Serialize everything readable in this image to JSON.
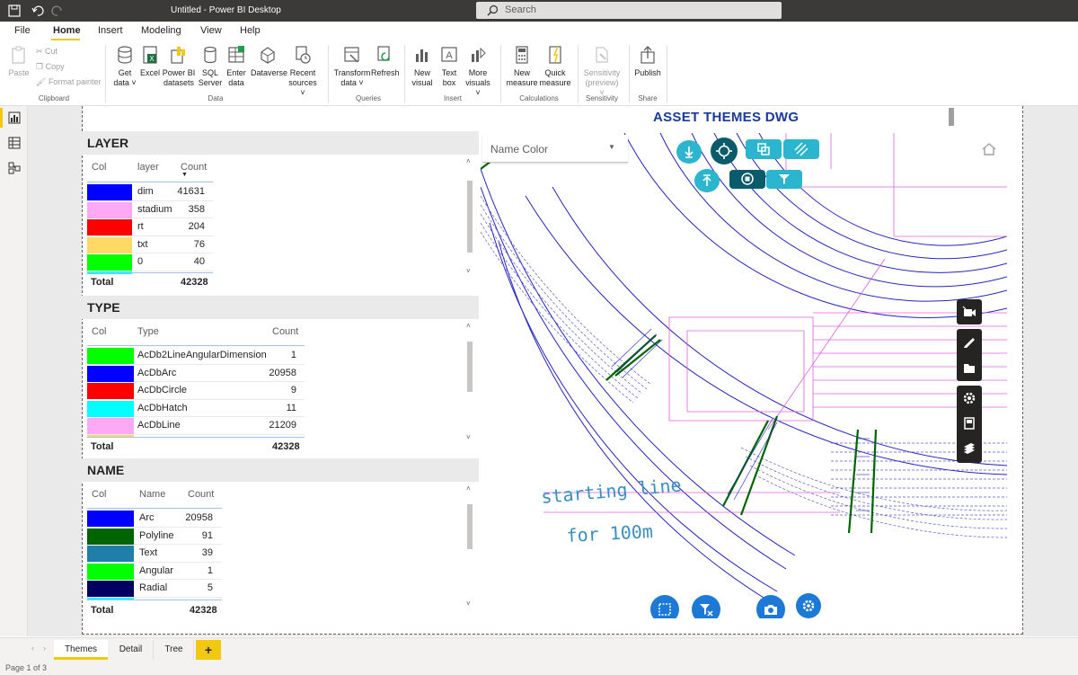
{
  "titlebar": {
    "title": "Untitled - Power BI Desktop",
    "search_placeholder": "Search"
  },
  "ribbon_tabs": [
    "File",
    "Home",
    "Insert",
    "Modeling",
    "View",
    "Help"
  ],
  "ribbon": {
    "clipboard": {
      "paste": "Paste",
      "cut": "Cut",
      "copy": "Copy",
      "format_painter": "Format painter",
      "group": "Clipboard"
    },
    "data": {
      "get_data": [
        "Get",
        "data ˅"
      ],
      "excel": [
        "Excel"
      ],
      "power_bi": [
        "Power BI",
        "datasets"
      ],
      "sql": [
        "SQL",
        "Server"
      ],
      "enter": [
        "Enter",
        "data"
      ],
      "dataverse": [
        "Dataverse"
      ],
      "recent": [
        "Recent",
        "sources ˅"
      ],
      "group": "Data"
    },
    "queries": {
      "transform": [
        "Transform",
        "data ˅"
      ],
      "refresh": [
        "Refresh"
      ],
      "group": "Queries"
    },
    "insert": {
      "new_visual": [
        "New",
        "visual"
      ],
      "text_box": [
        "Text",
        "box"
      ],
      "more_visuals": [
        "More",
        "visuals ˅"
      ],
      "group": "Insert"
    },
    "calculations": {
      "new_measure": [
        "New",
        "measure"
      ],
      "quick_measure": [
        "Quick",
        "measure"
      ],
      "group": "Calculations"
    },
    "sensitivity": {
      "label": [
        "Sensitivity",
        "(preview) ˅"
      ],
      "group": "Sensitivity"
    },
    "share": {
      "publish": [
        "Publish"
      ],
      "group": "Share"
    }
  },
  "report": {
    "title": "ASSET THEMES DWG",
    "layer": {
      "heading": "LAYER",
      "columns": [
        "Col",
        "layer",
        "Count"
      ],
      "rows": [
        {
          "color": "#0000ff",
          "name": "dim",
          "count": "41631"
        },
        {
          "color": "#ffa8f5",
          "name": "stadium",
          "count": "358"
        },
        {
          "color": "#ff0000",
          "name": "rt",
          "count": "204"
        },
        {
          "color": "#ffd966",
          "name": "txt",
          "count": "76"
        },
        {
          "color": "#00ff00",
          "name": "0",
          "count": "40"
        }
      ],
      "total_label": "Total",
      "total": "42328"
    },
    "type": {
      "heading": "TYPE",
      "columns": [
        "Col",
        "Type",
        "Count"
      ],
      "rows": [
        {
          "color": "#00ff00",
          "name": "AcDb2LineAngularDimension",
          "count": "1"
        },
        {
          "color": "#0000ff",
          "name": "AcDbArc",
          "count": "20958"
        },
        {
          "color": "#ff0000",
          "name": "AcDbCircle",
          "count": "9"
        },
        {
          "color": "#00ffff",
          "name": "AcDbHatch",
          "count": "11"
        },
        {
          "color": "#ffa8f5",
          "name": "AcDbLine",
          "count": "21209"
        }
      ],
      "total_label": "Total",
      "total": "42328"
    },
    "name": {
      "heading": "NAME",
      "columns": [
        "Col",
        "Name",
        "Count"
      ],
      "rows": [
        {
          "color": "#0000ff",
          "name": "Arc",
          "count": "20958"
        },
        {
          "color": "#006400",
          "name": "Polyline",
          "count": "91"
        },
        {
          "color": "#1f7fa8",
          "name": "Text",
          "count": "39"
        },
        {
          "color": "#00ff00",
          "name": "Angular",
          "count": "1"
        },
        {
          "color": "#000060",
          "name": "Radial",
          "count": "5"
        }
      ],
      "total_label": "Total",
      "total": "42328"
    },
    "drawing": {
      "dropdown_label": "Name Color",
      "text_line1": "starting line",
      "text_line2": "for 100m"
    }
  },
  "pages": {
    "tabs": [
      "Themes",
      "Detail",
      "Tree"
    ],
    "add": "+",
    "active": "Themes"
  },
  "status": {
    "page": "Page 1 of 3"
  },
  "colors": {
    "accent": "#f2c811",
    "title_blue": "#1a3a9c",
    "teal": "#2cb5cf"
  }
}
